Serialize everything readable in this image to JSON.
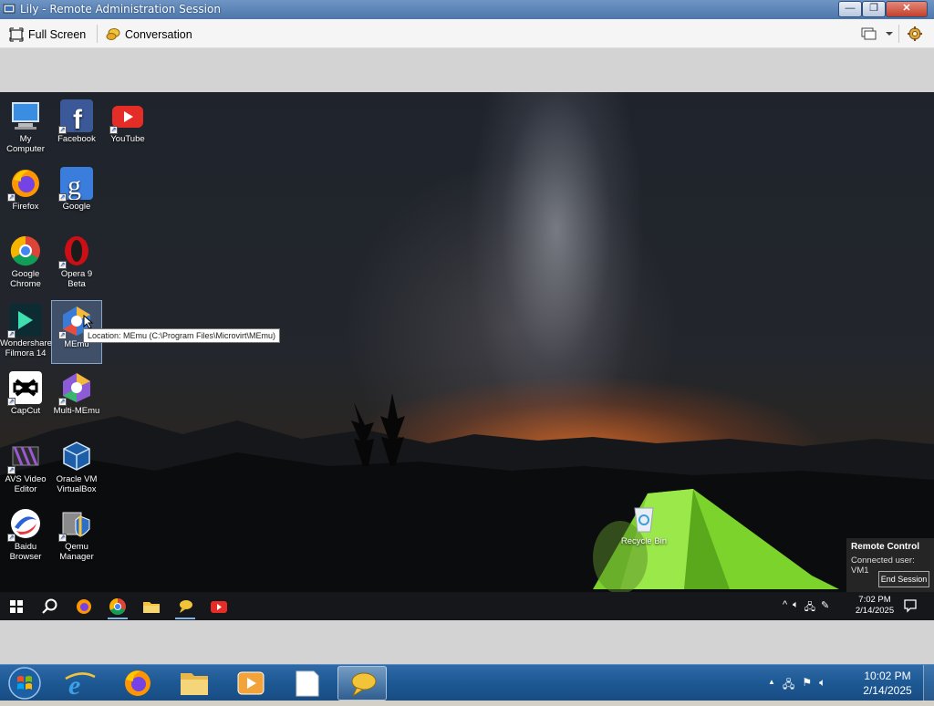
{
  "window": {
    "title": "Lily - Remote Administration Session",
    "minimize_label": "—",
    "maximize_label": "❐",
    "close_label": "✕"
  },
  "toolbar": {
    "fullscreen_label": "Full Screen",
    "conversation_label": "Conversation"
  },
  "desktop": {
    "icons": [
      {
        "label": "My Computer",
        "icon": "computer-icon"
      },
      {
        "label": "Facebook",
        "icon": "facebook-icon"
      },
      {
        "label": "YouTube",
        "icon": "youtube-icon"
      },
      {
        "label": "Firefox",
        "icon": "firefox-icon"
      },
      {
        "label": "Google",
        "icon": "google-icon"
      },
      {
        "label": "Google Chrome",
        "icon": "chrome-icon"
      },
      {
        "label": "Opera 9 Beta",
        "icon": "opera-icon"
      },
      {
        "label": "Wondershare Filmora 14",
        "icon": "filmora-icon"
      },
      {
        "label": "MEmu",
        "icon": "memu-icon"
      },
      {
        "label": "CapCut",
        "icon": "capcut-icon"
      },
      {
        "label": "Multi-MEmu",
        "icon": "multi-memu-icon"
      },
      {
        "label": "AVS Video Editor",
        "icon": "avs-icon"
      },
      {
        "label": "Oracle VM VirtualBox",
        "icon": "virtualbox-icon"
      },
      {
        "label": "Baidu Browser",
        "icon": "baidu-icon"
      },
      {
        "label": "Qemu Manager",
        "icon": "qemu-icon"
      }
    ],
    "tooltip": "Location: MEmu (C:\\Program Files\\Microvirt\\MEmu)",
    "recycle_bin": "Recycle Bin"
  },
  "remote_control": {
    "title": "Remote Control",
    "connected_user": "Connected user: VM1",
    "end_session_label": "End Session"
  },
  "remote_taskbar": {
    "time": "7:02 PM",
    "date": "2/14/2025",
    "tray_chevron": "^"
  },
  "local_taskbar": {
    "time": "10:02 PM",
    "date": "2/14/2025",
    "tray_chevron": "▲"
  }
}
